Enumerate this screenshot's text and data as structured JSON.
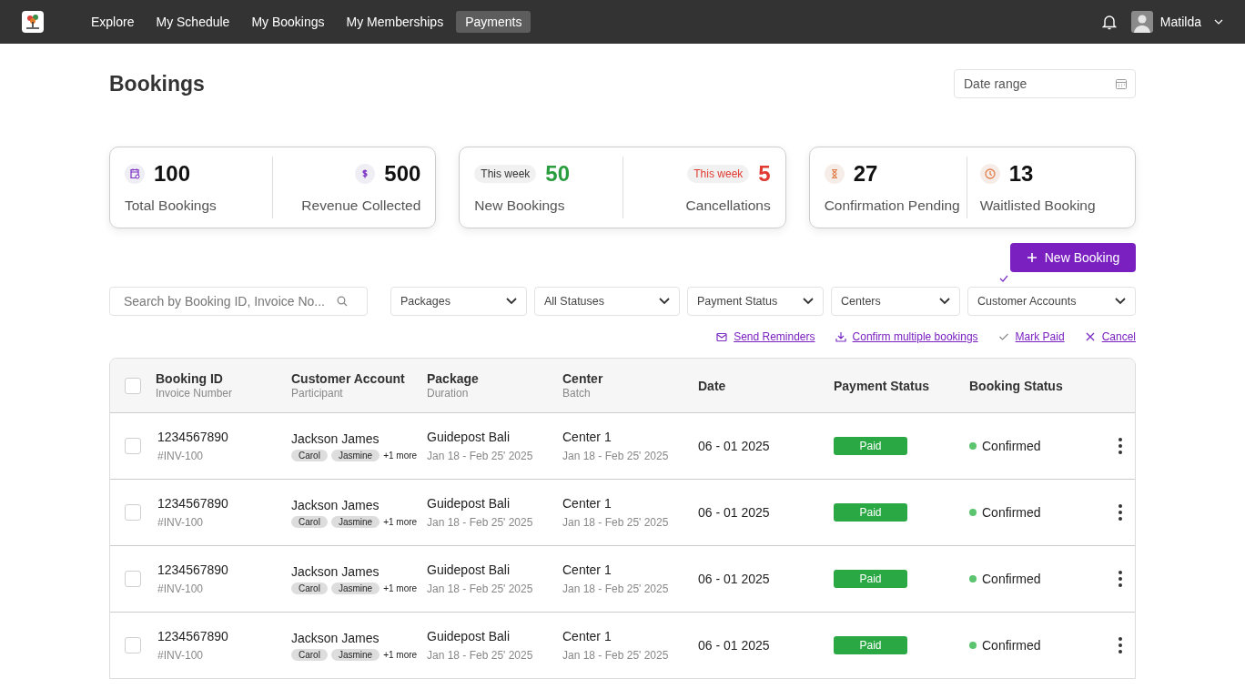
{
  "nav": {
    "items": [
      {
        "label": "Explore",
        "selected": false
      },
      {
        "label": "My Schedule",
        "selected": false
      },
      {
        "label": "My Bookings",
        "selected": false
      },
      {
        "label": "My Memberships",
        "selected": false
      },
      {
        "label": "Payments",
        "selected": true
      }
    ],
    "user": {
      "name": "Matilda"
    }
  },
  "title": "Bookings",
  "date_range": {
    "placeholder": "Date range"
  },
  "stats": [
    {
      "items": [
        {
          "kind": "icon",
          "value": "100",
          "label": "Total Bookings"
        },
        {
          "kind": "icon",
          "value": "500",
          "label": "Revenue Collected"
        }
      ]
    },
    {
      "items": [
        {
          "kind": "weekly",
          "badge": "This week",
          "alert": false,
          "color": "#2a9d3f",
          "value": "50",
          "label": "New Bookings"
        },
        {
          "kind": "weekly",
          "badge": "This week",
          "alert": true,
          "color": "#e03a32",
          "value": "5",
          "label": "Cancellations"
        }
      ]
    },
    {
      "items": [
        {
          "kind": "icon",
          "value": "27",
          "label": "Confirmation Pending"
        },
        {
          "kind": "icon",
          "value": "13",
          "label": "Waitlisted Booking"
        }
      ]
    }
  ],
  "new_booking": {
    "label": "New Booking"
  },
  "search": {
    "placeholder": "Search by Booking ID, Invoice No..."
  },
  "filters": [
    {
      "label": "Packages"
    },
    {
      "label": "All Statuses"
    },
    {
      "label": "Payment Status"
    },
    {
      "label": "Centers"
    },
    {
      "label": "Customer Accounts"
    }
  ],
  "actions": [
    {
      "label": "Send Reminders"
    },
    {
      "label": "Confirm multiple bookings"
    },
    {
      "label": "Mark Paid"
    },
    {
      "label": "Cancel"
    }
  ],
  "table": {
    "select_all": {
      "checked": false
    },
    "columns": [
      {
        "title": "Booking ID",
        "subtitle": "Invoice Number"
      },
      {
        "title": "Customer Account",
        "subtitle": "Participant"
      },
      {
        "title": "Package",
        "subtitle": "Duration"
      },
      {
        "title": "Center",
        "subtitle": "Batch"
      },
      {
        "title": "Date"
      },
      {
        "title": "Payment Status"
      },
      {
        "title": "Booking Status"
      }
    ],
    "rows": [
      {
        "checked": false,
        "booking_id": "1234567890",
        "invoice": "#INV-100",
        "customer": "Jackson James",
        "participants": [
          "Carol",
          "Jasmine"
        ],
        "more": "+1 more",
        "package": "Guidepost Bali",
        "duration": "Jan 18 - Feb 25' 2025",
        "center": "Center 1",
        "batch": "Jan 18 - Feb 25' 2025",
        "date": "06 - 01 2025",
        "payment": {
          "label": "Paid",
          "color": "#2aa843"
        },
        "status": {
          "label": "Confirmed",
          "color": "#5cc46f"
        }
      },
      {
        "checked": false,
        "booking_id": "1234567890",
        "invoice": "#INV-100",
        "customer": "Jackson James",
        "participants": [
          "Carol",
          "Jasmine"
        ],
        "more": "+1 more",
        "package": "Guidepost Bali",
        "duration": "Jan 18 - Feb 25' 2025",
        "center": "Center 1",
        "batch": "Jan 18 - Feb 25' 2025",
        "date": "06 - 01 2025",
        "payment": {
          "label": "Paid",
          "color": "#2aa843"
        },
        "status": {
          "label": "Confirmed",
          "color": "#5cc46f"
        }
      },
      {
        "checked": false,
        "booking_id": "1234567890",
        "invoice": "#INV-100",
        "customer": "Jackson James",
        "participants": [
          "Carol",
          "Jasmine"
        ],
        "more": "+1 more",
        "package": "Guidepost Bali",
        "duration": "Jan 18 - Feb 25' 2025",
        "center": "Center 1",
        "batch": "Jan 18 - Feb 25' 2025",
        "date": "06 - 01 2025",
        "payment": {
          "label": "Paid",
          "color": "#2aa843"
        },
        "status": {
          "label": "Confirmed",
          "color": "#5cc46f"
        }
      },
      {
        "checked": false,
        "booking_id": "1234567890",
        "invoice": "#INV-100",
        "customer": "Jackson James",
        "participants": [
          "Carol",
          "Jasmine"
        ],
        "more": "+1 more",
        "package": "Guidepost Bali",
        "duration": "Jan 18 - Feb 25' 2025",
        "center": "Center 1",
        "batch": "Jan 18 - Feb 25' 2025",
        "date": "06 - 01 2025",
        "payment": {
          "label": "Paid",
          "color": "#2aa843"
        },
        "status": {
          "label": "Confirmed",
          "color": "#5cc46f"
        }
      }
    ]
  }
}
